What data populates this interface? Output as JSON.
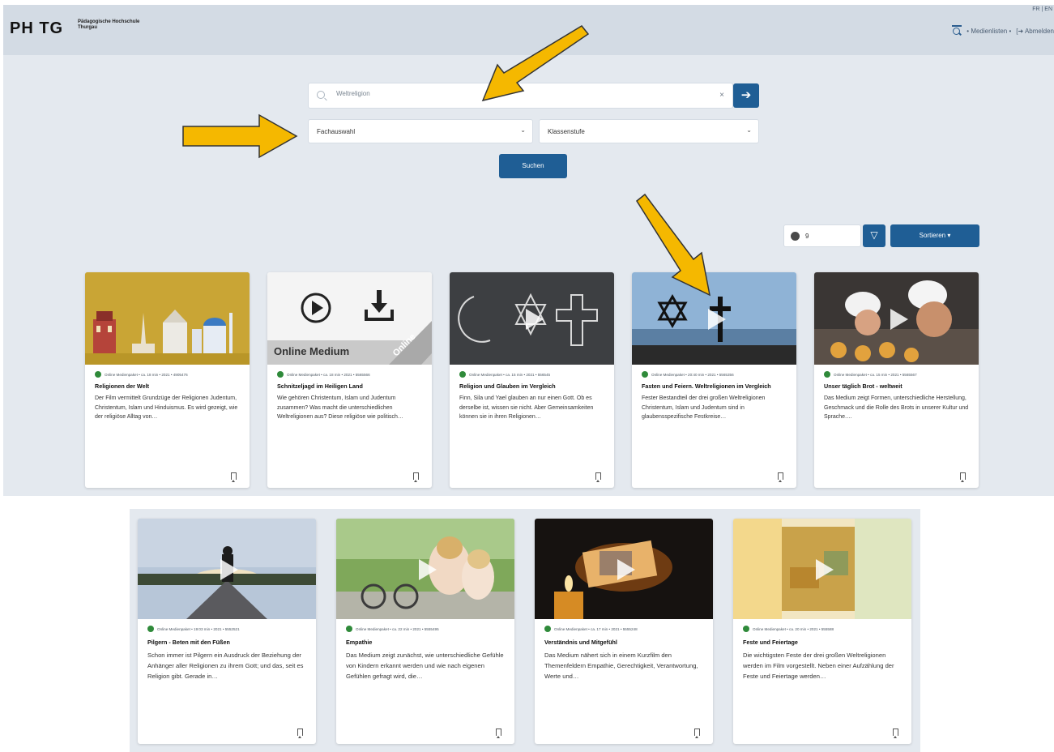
{
  "header": {
    "logo": "PH TG",
    "institution_line1": "Pädagogische Hochschule",
    "institution_line2": "Thurgau",
    "lang": "FR | EN",
    "nav_medienlisten": "• Medienlisten •",
    "nav_abmelden": "[➜ Abmelden"
  },
  "search": {
    "value": "Weltreligion",
    "clear": "×",
    "go": "➔",
    "fachauswahl": "Fachauswahl",
    "klassenstufe": "Klassenstufe",
    "button": "Suchen"
  },
  "results": {
    "count": "9",
    "filter_icon": "▽",
    "sort_label": "Sortieren ▾"
  },
  "cards_row1": [
    {
      "meta": "Online Medienpaket • ca. 18 min • 2021 • 4905476",
      "title": "Religionen der Welt",
      "desc": "Der Film vermittelt Grundzüge der Religionen Judentum, Christentum, Islam und Hinduismus. Es wird gezeigt, wie der religiöse Alltag von…"
    },
    {
      "meta": "Online Medienpaket • ca. 18 min • 2021 • 5565566",
      "title": "Schnitzeljagd im Heiligen Land",
      "desc": "Wie gehören Christentum, Islam und Judentum zusammen? Was macht die unterschiedlichen Weltreligionen aus? Diese religiöse wie politisch…",
      "thumb_label": "Online Medium",
      "ribbon": "Online"
    },
    {
      "meta": "Online Medienpaket • ca. 15 min • 2021 • 556545",
      "title": "Religion und Glauben im Vergleich",
      "desc": "Finn, Sila und Yael glauben an nur einen Gott. Ob es derselbe ist, wissen sie nicht. Aber Gemeinsamkeiten können sie in ihren Religionen…"
    },
    {
      "meta": "Online Medienpaket • 20:40 min • 2021 • 5565356",
      "title": "Fasten und Feiern. Weltreligionen im Vergleich",
      "desc": "Fester Bestandteil der drei großen Weltreligionen Christentum, Islam und Judentum sind in glaubensspezifische Festkreise…"
    },
    {
      "meta": "Online Medienpaket • ca. 15 min • 2021 • 5565567",
      "title": "Unser täglich Brot - weltweit",
      "desc": "Das Medium zeigt Formen, unterschiedliche Herstellung, Geschmack und die Rolle des Brots in unserer Kultur und Sprache.…"
    }
  ],
  "cards_row2": [
    {
      "meta": "Online Medienpaket • 19:03 min • 2021 • 5552521",
      "title": "Pilgern - Beten mit den Füßen",
      "desc": "Schon immer ist Pilgern ein Ausdruck der Beziehung der Anhänger aller Religionen zu ihrem Gott; und das, seit es Religion gibt. Gerade in…"
    },
    {
      "meta": "Online Medienpaket • ca. 22 min • 2021 • 5555495",
      "title": "Empathie",
      "desc": "Das Medium zeigt zunächst, wie unterschiedliche Gefühle von Kindern erkannt werden und wie nach eigenen Gefühlen gefragt wird, die…"
    },
    {
      "meta": "Online Medienpaket • ca. 17 min • 2021 • 5555248",
      "title": "Verständnis und Mitgefühl",
      "desc": "Das Medium nähert sich in einem Kurzfilm den Themenfeldern Empathie, Gerechtigkeit, Verantwortung, Werte und…"
    },
    {
      "meta": "Online Medienpaket • ca. 20 min • 2021 • 555588",
      "title": "Feste und Feiertage",
      "desc": "Die wichtigsten Feste der drei großen Weltreligionen werden im Film vorgestellt. Neben einer Aufzählung der Feste und Feiertage werden…"
    }
  ],
  "colors": {
    "primary": "#1f5e95",
    "arrow": "#f5b800",
    "panel": "#e4e9ef",
    "status_green": "#2f8a3a"
  }
}
